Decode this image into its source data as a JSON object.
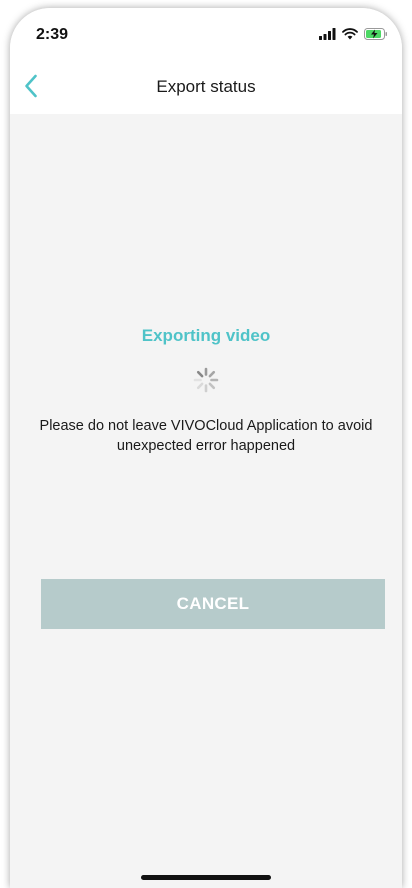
{
  "status_bar": {
    "time": "2:39",
    "icons": [
      "signal-icon",
      "wifi-icon",
      "battery-charging-icon"
    ]
  },
  "nav": {
    "title": "Export status",
    "back_icon": "chevron-left-icon"
  },
  "export": {
    "heading": "Exporting video",
    "message": "Please do not leave VIVOCloud Application to avoid unexpected error happened",
    "cancel_label": "CANCEL"
  },
  "colors": {
    "accent": "#4fc3c8",
    "button_bg": "#b6cbcb",
    "page_bg": "#f4f4f4"
  }
}
